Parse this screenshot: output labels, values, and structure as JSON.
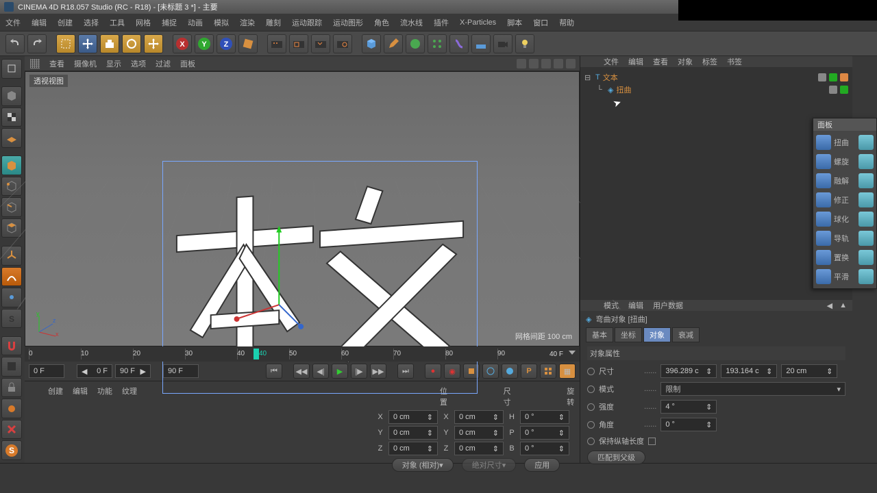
{
  "title": "CINEMA 4D R18.057 Studio (RC - R18) - [未标题 3 *] - 主要",
  "menu": [
    "文件",
    "编辑",
    "创建",
    "选择",
    "工具",
    "网格",
    "捕捉",
    "动画",
    "模拟",
    "渲染",
    "雕刻",
    "运动跟踪",
    "运动图形",
    "角色",
    "流水线",
    "插件",
    "X-Particles",
    "脚本",
    "窗口",
    "帮助"
  ],
  "vp_menu": [
    "查看",
    "摄像机",
    "显示",
    "选项",
    "过滤",
    "面板"
  ],
  "vp_label": "透视视图",
  "vp_grid": "网格间距  100 cm",
  "timeline_ticks": [
    "0",
    "10",
    "20",
    "30",
    "40",
    "50",
    "60",
    "70",
    "80",
    "90"
  ],
  "timeline_head": "40",
  "timeline_right": "40 F",
  "range": {
    "from": "0 F",
    "a": "0 F",
    "b": "90 F",
    "to": "90 F"
  },
  "lower_left_tabs": [
    "创建",
    "编辑",
    "功能",
    "纹理"
  ],
  "coord": {
    "hdr": [
      "位置",
      "尺寸",
      "旋转"
    ],
    "rows": [
      {
        "a": "X",
        "p": "0 cm",
        "s": "0 cm",
        "r": "H",
        "rv": "0 °"
      },
      {
        "a": "Y",
        "p": "0 cm",
        "s": "0 cm",
        "r": "P",
        "rv": "0 °"
      },
      {
        "a": "Z",
        "p": "0 cm",
        "s": "0 cm",
        "r": "B",
        "rv": "0 °"
      }
    ],
    "mode": "对象 (相对)",
    "abs": "绝对尺寸",
    "apply": "应用"
  },
  "rp_menu": [
    "文件",
    "编辑",
    "查看",
    "对象",
    "标签",
    "书签"
  ],
  "tree": [
    {
      "name": "文本",
      "icon": "text",
      "color": "#d89040"
    },
    {
      "name": "扭曲",
      "icon": "bend",
      "color": "#d89040",
      "indent": true
    }
  ],
  "rp_mid": [
    "模式",
    "编辑",
    "用户数据"
  ],
  "attr_title": "弯曲对象 [扭曲]",
  "tabs": [
    "基本",
    "坐标",
    "对象",
    "衰减"
  ],
  "tab_sel": 2,
  "section": "对象属性",
  "attrs": {
    "size_label": "尺寸",
    "size": [
      "396.289 c",
      "193.164 c",
      "20 cm"
    ],
    "mode_label": "模式",
    "mode": "限制",
    "strength_label": "强度",
    "strength": "4 °",
    "angle_label": "角度",
    "angle": "0 °",
    "keep_label": "保持纵轴长度",
    "fit_parent": "匹配到父级"
  },
  "float": {
    "title": "面板",
    "items": [
      "扭曲",
      "螺旋",
      "融解",
      "修正",
      "球化",
      "导轨",
      "置换",
      "平滑"
    ]
  }
}
